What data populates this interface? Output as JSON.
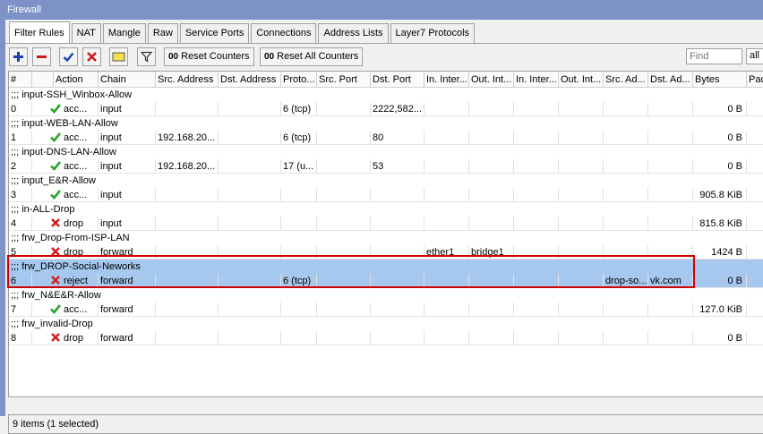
{
  "window": {
    "title": "Firewall"
  },
  "tabs": [
    "Filter Rules",
    "NAT",
    "Mangle",
    "Raw",
    "Service Ports",
    "Connections",
    "Address Lists",
    "Layer7 Protocols"
  ],
  "toolbar": {
    "reset_counters": "Reset Counters",
    "reset_all_counters": "Reset All Counters",
    "counter_prefix": "00",
    "find_placeholder": "Find",
    "filter_value": "all"
  },
  "columns": [
    "#",
    "",
    "Action",
    "Chain",
    "Src. Address",
    "Dst. Address",
    "Proto...",
    "Src. Port",
    "Dst. Port",
    "In. Inter...",
    "Out. Int...",
    "In. Inter...",
    "Out. Int...",
    "Src. Ad...",
    "Dst. Ad...",
    "Bytes",
    "Pack"
  ],
  "rules": [
    {
      "comment": ";;; input-SSH_Winbox-Allow",
      "num": "0",
      "action": "acc...",
      "icon": "check",
      "chain": "input",
      "src": "",
      "dst": "",
      "proto": "6 (tcp)",
      "sport": "",
      "dport": "2222,582...",
      "iin": "",
      "oint": "",
      "iin2": "",
      "oint2": "",
      "srcl": "",
      "dstl": "",
      "bytes": "0 B"
    },
    {
      "comment": ";;; input-WEB-LAN-Allow",
      "num": "1",
      "action": "acc...",
      "icon": "check",
      "chain": "input",
      "src": "192.168.20...",
      "dst": "",
      "proto": "6 (tcp)",
      "sport": "",
      "dport": "80",
      "iin": "",
      "oint": "",
      "iin2": "",
      "oint2": "",
      "srcl": "",
      "dstl": "",
      "bytes": "0 B"
    },
    {
      "comment": ";;; input-DNS-LAN-Allow",
      "num": "2",
      "action": "acc...",
      "icon": "check",
      "chain": "input",
      "src": "192.168.20...",
      "dst": "",
      "proto": "17 (u...",
      "sport": "",
      "dport": "53",
      "iin": "",
      "oint": "",
      "iin2": "",
      "oint2": "",
      "srcl": "",
      "dstl": "",
      "bytes": "0 B"
    },
    {
      "comment": ";;; input_E&R-Allow",
      "num": "3",
      "action": "acc...",
      "icon": "check",
      "chain": "input",
      "src": "",
      "dst": "",
      "proto": "",
      "sport": "",
      "dport": "",
      "iin": "",
      "oint": "",
      "iin2": "",
      "oint2": "",
      "srcl": "",
      "dstl": "",
      "bytes": "905.8 KiB"
    },
    {
      "comment": ";;; in-ALL-Drop",
      "num": "4",
      "action": "drop",
      "icon": "x",
      "chain": "input",
      "src": "",
      "dst": "",
      "proto": "",
      "sport": "",
      "dport": "",
      "iin": "",
      "oint": "",
      "iin2": "",
      "oint2": "",
      "srcl": "",
      "dstl": "",
      "bytes": "815.8 KiB"
    },
    {
      "comment": ";;; frw_Drop-From-ISP-LAN",
      "num": "5",
      "action": "drop",
      "icon": "x",
      "chain": "forward",
      "src": "",
      "dst": "",
      "proto": "",
      "sport": "",
      "dport": "",
      "iin": "ether1",
      "oint": "bridge1",
      "iin2": "",
      "oint2": "",
      "srcl": "",
      "dstl": "",
      "bytes": "1424 B"
    },
    {
      "comment": ";;; frw_DROP-Social-Neworks",
      "num": "6",
      "action": "reject",
      "icon": "x",
      "chain": "forward",
      "src": "",
      "dst": "",
      "proto": "6 (tcp)",
      "sport": "",
      "dport": "",
      "iin": "",
      "oint": "",
      "iin2": "",
      "oint2": "",
      "srcl": "drop-so...",
      "dstl": "vk.com",
      "bytes": "0 B",
      "selected": true
    },
    {
      "comment": ";;; frw_N&E&R-Allow",
      "num": "7",
      "action": "acc...",
      "icon": "check",
      "chain": "forward",
      "src": "",
      "dst": "",
      "proto": "",
      "sport": "",
      "dport": "",
      "iin": "",
      "oint": "",
      "iin2": "",
      "oint2": "",
      "srcl": "",
      "dstl": "",
      "bytes": "127.0 KiB"
    },
    {
      "comment": ";;; frw_invalid-Drop",
      "num": "8",
      "action": "drop",
      "icon": "x",
      "chain": "forward",
      "src": "",
      "dst": "",
      "proto": "",
      "sport": "",
      "dport": "",
      "iin": "",
      "oint": "",
      "iin2": "",
      "oint2": "",
      "srcl": "",
      "dstl": "",
      "bytes": "0 B"
    }
  ],
  "status": {
    "text": "9 items (1 selected)"
  },
  "colors": {
    "title_bar": "#7d93c8",
    "selection": "#a6c8ee",
    "highlight": "#d00000",
    "accept": "#2aa52a",
    "drop": "#d22020"
  }
}
